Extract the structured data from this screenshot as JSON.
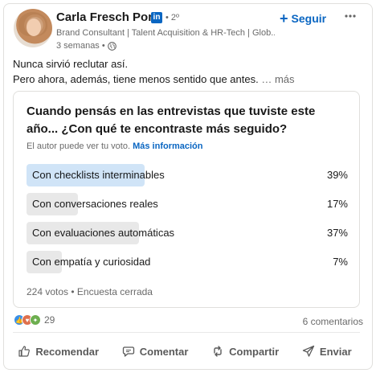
{
  "author": {
    "name": "Carla Fresch Pons",
    "degree": "• 2º",
    "headline": "Brand Consultant | Talent Acquisition & HR-Tech | Glob...",
    "time": "3 semanas •"
  },
  "header": {
    "follow_label": "Seguir",
    "more_icon": "more-horizontal-icon"
  },
  "post": {
    "line1": "Nunca sirvió reclutar así.",
    "line2": "Pero ahora, además, tiene menos sentido que antes.",
    "see_more": "… más"
  },
  "poll": {
    "question": "Cuando pensás en las entrevistas que tuviste este año... ¿Con qué te encontraste más seguido?",
    "visibility_note": "El autor puede ver tu voto.",
    "info_link": "Más información",
    "options": [
      {
        "label": "Con checklists interminables",
        "pct_text": "39%",
        "value": 39,
        "selected": true
      },
      {
        "label": "Con conversaciones reales",
        "pct_text": "17%",
        "value": 17,
        "selected": false
      },
      {
        "label": "Con evaluaciones automáticas",
        "pct_text": "37%",
        "value": 37,
        "selected": false
      },
      {
        "label": "Con empatía y curiosidad",
        "pct_text": "7%",
        "value": 7,
        "selected": false
      }
    ],
    "footer": "224 votos • Encuesta cerrada"
  },
  "social": {
    "reaction_count": "29",
    "comments": "6 comentarios"
  },
  "actions": {
    "like": "Recomendar",
    "comment": "Comentar",
    "repost": "Compartir",
    "send": "Enviar"
  },
  "colors": {
    "accent": "#0a66c2",
    "selected_bar": "#d0e4f7",
    "bar": "#e8e8e8"
  }
}
